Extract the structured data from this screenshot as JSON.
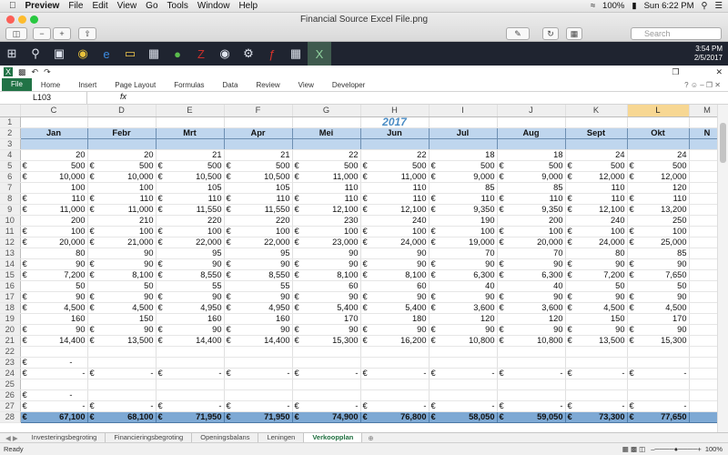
{
  "menubar": {
    "apple": "",
    "app": "Preview",
    "items": [
      "File",
      "Edit",
      "View",
      "Go",
      "Tools",
      "Window",
      "Help"
    ],
    "battery": "100%",
    "clock": "Sun 6:22 PM"
  },
  "preview": {
    "title": "Financial Source Excel File.png",
    "search_placeholder": "Search"
  },
  "taskbar": {
    "time": "3:54 PM",
    "date": "2/5/2017"
  },
  "ribbon": {
    "tabs": [
      "File",
      "Home",
      "Insert",
      "Page Layout",
      "Formulas",
      "Data",
      "Review",
      "View",
      "Developer"
    ]
  },
  "formula_bar": {
    "name_box": "L103",
    "fx": "fx"
  },
  "sheet": {
    "columns": [
      "C",
      "D",
      "E",
      "F",
      "G",
      "H",
      "I",
      "J",
      "K",
      "L",
      "M"
    ],
    "selected_column": "L",
    "year": "2017",
    "months": [
      "Jan",
      "Febr",
      "Mrt",
      "Apr",
      "Mei",
      "Jun",
      "Jul",
      "Aug",
      "Sept",
      "Okt",
      "N"
    ],
    "rows": [
      {
        "n": "4",
        "e": false,
        "v": [
          "20",
          "20",
          "21",
          "21",
          "22",
          "22",
          "18",
          "18",
          "24",
          "24",
          ""
        ]
      },
      {
        "n": "5",
        "e": true,
        "v": [
          "500",
          "500",
          "500",
          "500",
          "500",
          "500",
          "500",
          "500",
          "500",
          "500",
          ""
        ]
      },
      {
        "n": "6",
        "e": true,
        "v": [
          "10,000",
          "10,000",
          "10,500",
          "10,500",
          "11,000",
          "11,000",
          "9,000",
          "9,000",
          "12,000",
          "12,000",
          ""
        ]
      },
      {
        "n": "7",
        "e": false,
        "v": [
          "100",
          "100",
          "105",
          "105",
          "110",
          "110",
          "85",
          "85",
          "110",
          "120",
          ""
        ]
      },
      {
        "n": "8",
        "e": true,
        "v": [
          "110",
          "110",
          "110",
          "110",
          "110",
          "110",
          "110",
          "110",
          "110",
          "110",
          ""
        ]
      },
      {
        "n": "9",
        "e": true,
        "v": [
          "11,000",
          "11,000",
          "11,550",
          "11,550",
          "12,100",
          "12,100",
          "9,350",
          "9,350",
          "12,100",
          "13,200",
          ""
        ]
      },
      {
        "n": "10",
        "e": false,
        "v": [
          "200",
          "210",
          "220",
          "220",
          "230",
          "240",
          "190",
          "200",
          "240",
          "250",
          ""
        ]
      },
      {
        "n": "11",
        "e": true,
        "v": [
          "100",
          "100",
          "100",
          "100",
          "100",
          "100",
          "100",
          "100",
          "100",
          "100",
          ""
        ]
      },
      {
        "n": "12",
        "e": true,
        "v": [
          "20,000",
          "21,000",
          "22,000",
          "22,000",
          "23,000",
          "24,000",
          "19,000",
          "20,000",
          "24,000",
          "25,000",
          ""
        ]
      },
      {
        "n": "13",
        "e": false,
        "v": [
          "80",
          "90",
          "95",
          "95",
          "90",
          "90",
          "70",
          "70",
          "80",
          "85",
          ""
        ]
      },
      {
        "n": "14",
        "e": true,
        "v": [
          "90",
          "90",
          "90",
          "90",
          "90",
          "90",
          "90",
          "90",
          "90",
          "90",
          ""
        ]
      },
      {
        "n": "15",
        "e": true,
        "v": [
          "7,200",
          "8,100",
          "8,550",
          "8,550",
          "8,100",
          "8,100",
          "6,300",
          "6,300",
          "7,200",
          "7,650",
          ""
        ]
      },
      {
        "n": "16",
        "e": false,
        "v": [
          "50",
          "50",
          "55",
          "55",
          "60",
          "60",
          "40",
          "40",
          "50",
          "50",
          ""
        ]
      },
      {
        "n": "17",
        "e": true,
        "v": [
          "90",
          "90",
          "90",
          "90",
          "90",
          "90",
          "90",
          "90",
          "90",
          "90",
          ""
        ]
      },
      {
        "n": "18",
        "e": true,
        "v": [
          "4,500",
          "4,500",
          "4,950",
          "4,950",
          "5,400",
          "5,400",
          "3,600",
          "3,600",
          "4,500",
          "4,500",
          ""
        ]
      },
      {
        "n": "19",
        "e": false,
        "v": [
          "160",
          "150",
          "160",
          "160",
          "170",
          "180",
          "120",
          "120",
          "150",
          "170",
          ""
        ]
      },
      {
        "n": "20",
        "e": true,
        "v": [
          "90",
          "90",
          "90",
          "90",
          "90",
          "90",
          "90",
          "90",
          "90",
          "90",
          ""
        ]
      },
      {
        "n": "21",
        "e": true,
        "v": [
          "14,400",
          "13,500",
          "14,400",
          "14,400",
          "15,300",
          "16,200",
          "10,800",
          "10,800",
          "13,500",
          "15,300",
          ""
        ]
      },
      {
        "n": "22",
        "e": false,
        "v": [
          "",
          "",
          "",
          "",
          "",
          "",
          "",
          "",
          "",
          "",
          ""
        ]
      },
      {
        "n": "23",
        "e": true,
        "single": true,
        "v": [
          "-",
          "",
          "",
          "",
          "",
          "",
          "",
          "",
          "",
          "",
          ""
        ]
      },
      {
        "n": "24",
        "e": true,
        "v": [
          "-",
          "-",
          "-",
          "-",
          "-",
          "-",
          "-",
          "-",
          "-",
          "-",
          ""
        ]
      },
      {
        "n": "25",
        "e": false,
        "v": [
          "",
          "",
          "",
          "",
          "",
          "",
          "",
          "",
          "",
          "",
          ""
        ]
      },
      {
        "n": "26",
        "e": true,
        "single": true,
        "v": [
          "-",
          "",
          "",
          "",
          "",
          "",
          "",
          "",
          "",
          "",
          ""
        ]
      },
      {
        "n": "27",
        "e": true,
        "v": [
          "-",
          "-",
          "-",
          "-",
          "-",
          "-",
          "-",
          "-",
          "-",
          "-",
          ""
        ]
      }
    ],
    "total": {
      "n": "28",
      "v": [
        "67,100",
        "68,100",
        "71,950",
        "71,950",
        "74,900",
        "76,800",
        "58,050",
        "59,050",
        "73,300",
        "77,650",
        ""
      ]
    }
  },
  "sheet_tabs": [
    "Investeringsbegroting",
    "Financieringsbegroting",
    "Openingsbalans",
    "Leningen",
    "Verkoopplan"
  ],
  "active_tab": "Verkoopplan",
  "status": {
    "ready": "Ready",
    "zoom": "100%"
  }
}
